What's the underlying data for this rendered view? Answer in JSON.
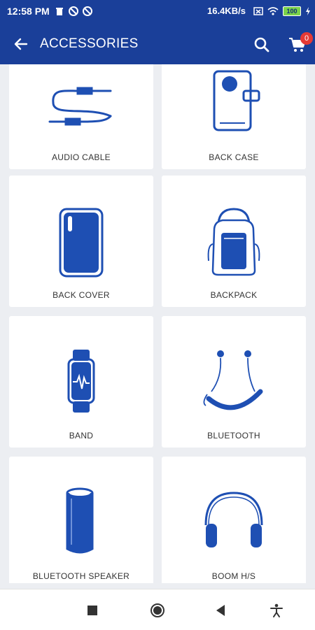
{
  "status_bar": {
    "time": "12:58 PM",
    "network_speed": "16.4KB/s",
    "battery": "100"
  },
  "app_bar": {
    "title": "ACCESSORIES",
    "cart_count": "0"
  },
  "colors": {
    "primary": "#1a3f99",
    "icon_blue": "#1e4fb3",
    "badge": "#e53935",
    "background": "#eceef2"
  },
  "categories": [
    {
      "label": "AUDIO CABLE",
      "icon": "audio-cable-icon"
    },
    {
      "label": "BACK CASE",
      "icon": "back-case-icon"
    },
    {
      "label": "BACK COVER",
      "icon": "back-cover-icon"
    },
    {
      "label": "BACKPACK",
      "icon": "backpack-icon"
    },
    {
      "label": "BAND",
      "icon": "band-icon"
    },
    {
      "label": "BLUETOOTH",
      "icon": "bluetooth-neckband-icon"
    },
    {
      "label": "BLUETOOTH SPEAKER",
      "icon": "bluetooth-speaker-icon"
    },
    {
      "label": "BOOM H/S",
      "icon": "headphones-icon"
    }
  ],
  "nav_bar": {
    "items": [
      "recent-apps-icon",
      "home-icon",
      "back-triangle-icon",
      "accessibility-icon"
    ]
  }
}
